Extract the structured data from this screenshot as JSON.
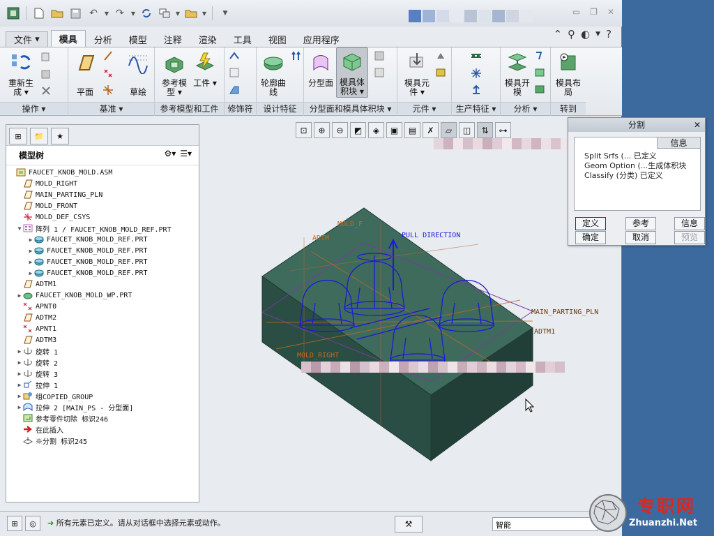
{
  "qat": {
    "icons": [
      "app-icon",
      "new-icon",
      "open-icon",
      "save-icon",
      "undo-icon",
      "redo-icon",
      "regenerate-icon",
      "windows-icon",
      "folder-icon",
      "dropdown-icon"
    ]
  },
  "ribbon": {
    "tabs": [
      {
        "label": "文件"
      },
      {
        "label": "模具"
      },
      {
        "label": "分析"
      },
      {
        "label": "模型"
      },
      {
        "label": "注释"
      },
      {
        "label": "渲染"
      },
      {
        "label": "工具"
      },
      {
        "label": "视图"
      },
      {
        "label": "应用程序"
      }
    ],
    "groups": [
      {
        "label": "操作 ▾"
      },
      {
        "label": "基准 ▾"
      },
      {
        "label": "参考模型和工件"
      },
      {
        "label": "修饰符"
      },
      {
        "label": "设计特征"
      },
      {
        "label": "分型面和模具体积块 ▾"
      },
      {
        "label": "元件 ▾"
      },
      {
        "label": "生产特征 ▾"
      },
      {
        "label": "分析 ▾"
      },
      {
        "label": "转到"
      }
    ],
    "buttons": {
      "regenerate": "重新生成 ▾",
      "plane": "平面",
      "sketch": "草绘",
      "ref_model": "参考模型 ▾",
      "workpiece": "工件 ▾",
      "silhouette": "轮廓曲线",
      "parting_surface": "分型面",
      "mold_volume": "模具体积块 ▾",
      "mold_component": "模具元件 ▾",
      "mold_open": "模具开模",
      "mold_layout": "模具布局"
    }
  },
  "model_tree": {
    "header": "模型树",
    "items": [
      {
        "text": "FAUCET_KNOB_MOLD.ASM",
        "icon": "assembly-icon",
        "expander": ""
      },
      {
        "text": "MOLD_RIGHT",
        "icon": "datum-plane-icon",
        "expander": ""
      },
      {
        "text": "MAIN_PARTING_PLN",
        "icon": "datum-plane-icon",
        "expander": ""
      },
      {
        "text": "MOLD_FRONT",
        "icon": "datum-plane-icon",
        "expander": ""
      },
      {
        "text": "MOLD_DEF_CSYS",
        "icon": "csys-icon",
        "expander": ""
      },
      {
        "text": "阵列 1 / FAUCET_KNOB_MOLD_REF.PRT",
        "icon": "pattern-icon",
        "expander": "▼"
      },
      {
        "text": "FAUCET_KNOB_MOLD_REF.PRT",
        "icon": "part-icon",
        "expander": "▶"
      },
      {
        "text": "FAUCET_KNOB_MOLD_REF.PRT",
        "icon": "part-icon",
        "expander": "▶"
      },
      {
        "text": "FAUCET_KNOB_MOLD_REF.PRT",
        "icon": "part-icon",
        "expander": "▶"
      },
      {
        "text": "FAUCET_KNOB_MOLD_REF.PRT",
        "icon": "part-icon",
        "expander": "▶"
      },
      {
        "text": "ADTM1",
        "icon": "datum-plane-icon",
        "expander": ""
      },
      {
        "text": "FAUCET_KNOB_MOLD_WP.PRT",
        "icon": "workpiece-icon",
        "expander": "▶"
      },
      {
        "text": "APNT0",
        "icon": "datum-point-icon",
        "expander": ""
      },
      {
        "text": "ADTM2",
        "icon": "datum-plane-icon",
        "expander": ""
      },
      {
        "text": "APNT1",
        "icon": "datum-point-icon",
        "expander": ""
      },
      {
        "text": "ADTM3",
        "icon": "datum-plane-icon",
        "expander": ""
      },
      {
        "text": "旋转 1",
        "icon": "revolve-icon",
        "expander": "▶"
      },
      {
        "text": "旋转 2",
        "icon": "revolve-icon",
        "expander": "▶"
      },
      {
        "text": "旋转 3",
        "icon": "revolve-icon",
        "expander": "▶"
      },
      {
        "text": "拉伸 1",
        "icon": "extrude-icon",
        "expander": "▶"
      },
      {
        "text": "组COPIED_GROUP",
        "icon": "group-icon",
        "expander": "▶"
      },
      {
        "text": "拉伸 2 [MAIN_PS - 分型面]",
        "icon": "surface-icon",
        "expander": "▶"
      },
      {
        "text": "参考零件切除 标识246",
        "icon": "cut-icon",
        "expander": ""
      },
      {
        "text": "在此插入",
        "icon": "insert-arrow-icon",
        "expander": ""
      },
      {
        "text": "※分割 标识245",
        "icon": "split-icon",
        "expander": ""
      }
    ]
  },
  "graphics": {
    "labels": {
      "pull_direction": "PULL DIRECTION",
      "main_parting": "MAIN_PARTING_PLN",
      "adtm1": "ADTM1",
      "mold_right": "MOLD_RIGHT",
      "mold_front": "MOLD_F",
      "adtm": "ADTM"
    }
  },
  "split_dialog": {
    "title": "分割",
    "column_header": "信息",
    "rows": [
      "Split Srfs (... 已定义",
      "Geom Option (...生成体积块",
      "Classify (分类) 已定义"
    ],
    "buttons": {
      "define": "定义",
      "reference": "参考",
      "info": "信息",
      "ok": "确定",
      "cancel": "取消",
      "preview": "预览"
    }
  },
  "status_bar": {
    "message": "所有元素已定义。请从对话框中选择元素或动作。",
    "filter_value": "智能"
  },
  "watermark": {
    "text": "专职网",
    "url": "Zhuanzhi.Net"
  },
  "colors": {
    "model_fill": "#2e5a4d",
    "wireframe": "#1a1ad8",
    "datum": "#c26a1e",
    "app_bg": "#e8ebef",
    "desktop": "#3d6a9e"
  }
}
